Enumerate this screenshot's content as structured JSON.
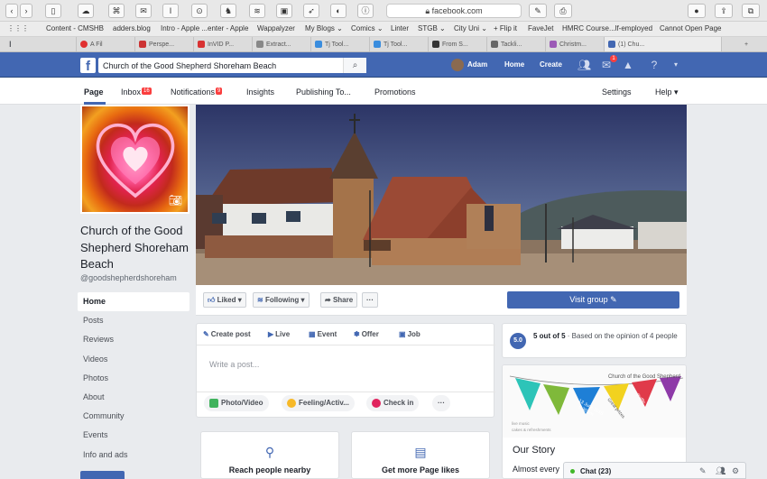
{
  "browser": {
    "url": "facebook.com",
    "bookmarks": [
      "Content - CMSHB",
      "adders.blog",
      "Intro - Apple ...enter - Apple",
      "Wappalyzer",
      "My Blogs ⌄",
      "Comics ⌄",
      "Linter",
      "STGB ⌄",
      "City Uni ⌄",
      "+ Flip it",
      "FaveJet",
      "HMRC Course...lf-employed",
      "Cannot Open Page"
    ],
    "tabs": [
      "A Fil",
      "Perspe...",
      "InVID P...",
      "Extract...",
      "Tj Tool...",
      "Tj Tool...",
      "From S...",
      "Tackli...",
      "Christm...",
      "(1) Chu..."
    ]
  },
  "fb": {
    "search_value": "Church of the Good Shepherd Shoreham Beach",
    "user_name": "Adam",
    "home": "Home",
    "create": "Create",
    "msg_badge": "1"
  },
  "page_nav": {
    "page": "Page",
    "inbox": "Inbox",
    "inbox_badge": "16",
    "notifications": "Notifications",
    "notifications_badge": "9",
    "insights": "Insights",
    "publishing": "Publishing To...",
    "promotions": "Promotions",
    "settings": "Settings",
    "help": "Help ▾"
  },
  "profile": {
    "name": "Church of the Good Shepherd Shoreham Beach",
    "handle": "@goodshepherdshoreham"
  },
  "left_menu": [
    "Home",
    "Posts",
    "Reviews",
    "Videos",
    "Photos",
    "About",
    "Community",
    "Events",
    "Info and ads"
  ],
  "actions": {
    "liked": "Liked ▾",
    "following": "Following ▾",
    "share": "Share",
    "more": "···",
    "visit": "Visit group"
  },
  "composer": {
    "tabs": [
      "Create post",
      "Live",
      "Event",
      "Offer",
      "Job"
    ],
    "placeholder": "Write a post...",
    "pills": [
      "Photo/Video",
      "Feeling/Activ...",
      "Check in",
      "···"
    ]
  },
  "cards": [
    "Reach people nearby",
    "Get more Page likes"
  ],
  "rating": {
    "score": "5.0",
    "bold": "5 out of 5",
    "text": "· Based on the opinion of 4 people"
  },
  "story": {
    "img_title": "Church of the Good Shepherd",
    "flag_text": [
      "13 June 2018",
      "6.30 pm",
      "Great prizes",
      "Raffle"
    ],
    "img_notes": [
      "live music",
      "cakes & refreshments"
    ],
    "title": "Our Story",
    "text": "Almost every"
  },
  "chat": {
    "label": "Chat (23)"
  },
  "colors": {
    "fb_blue": "#4267b2",
    "badge_red": "#fa3e3e",
    "online_green": "#42b72a"
  }
}
